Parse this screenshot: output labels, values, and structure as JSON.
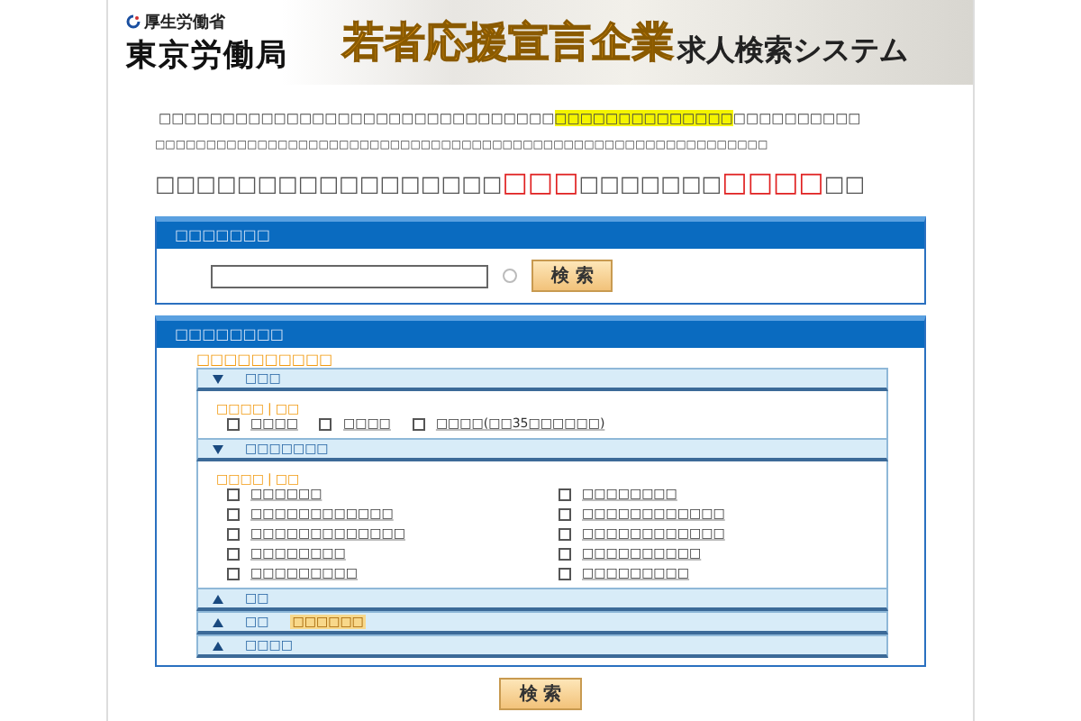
{
  "header": {
    "ministry": "厚生労働省",
    "bureau": "東京労働局",
    "title_highlight": "若者応援宣言企業",
    "title": "求人検索システム"
  },
  "intro": {
    "before": "□□□□□□□□□□□□□□□□□□□□□□□□□□□□□□□",
    "highlight": "□□□□□□□□□□□□□□",
    "after": "□□□□□□□□□□"
  },
  "note": "□□□□□□□□□□□□□□□□□□□□□□□□□□□□□□□□□□□□□□□□□□□□□□□□□□□□□□□□□□□□",
  "headline": [
    {
      "text": "□□□□□□□□□□□□□□□□□",
      "red": false
    },
    {
      "text": "□□□",
      "red": true
    },
    {
      "text": "□□□□□□□",
      "red": false
    },
    {
      "text": "□□□□",
      "red": true
    },
    {
      "text": "□□",
      "red": false
    }
  ],
  "keyword_panel": {
    "title": "□□□□□□□",
    "button": "検 索"
  },
  "condition_panel": {
    "title": "□□□□□□□□",
    "label": "□□□□□□□□□□",
    "sections": [
      {
        "title": "□□□",
        "expanded": true,
        "select_all": "□□□□",
        "separator": "|",
        "clear": "□□",
        "kind": "row",
        "options": [
          {
            "label": "□□□□",
            "checked": false
          },
          {
            "label": "□□□□",
            "checked": false
          },
          {
            "label": "□□□□(□□35□□□□□□)",
            "checked": false
          }
        ]
      },
      {
        "title": "□□□□□□□",
        "expanded": true,
        "select_all": "□□□□",
        "separator": "|",
        "clear": "□□",
        "kind": "grid",
        "options": [
          {
            "label": "□□□□□□",
            "checked": false
          },
          {
            "label": "□□□□□□□□□□□□",
            "checked": false
          },
          {
            "label": "□□□□□□□□□□□□□",
            "checked": false
          },
          {
            "label": "□□□□□□□□",
            "checked": false
          },
          {
            "label": "□□□□□□□□□",
            "checked": false
          },
          {
            "label": "□□□□□□□□",
            "checked": false
          },
          {
            "label": "□□□□□□□□□□□□",
            "checked": false
          },
          {
            "label": "□□□□□□□□□□□□",
            "checked": false
          },
          {
            "label": "□□□□□□□□□□",
            "checked": false
          },
          {
            "label": "□□□□□□□□□",
            "checked": false
          }
        ]
      },
      {
        "title": "□□",
        "expanded": false
      },
      {
        "title": "□□",
        "expanded": false,
        "tag": "□□□□□□"
      },
      {
        "title": "□□□□",
        "expanded": false
      }
    ]
  },
  "search_button": "検 索"
}
